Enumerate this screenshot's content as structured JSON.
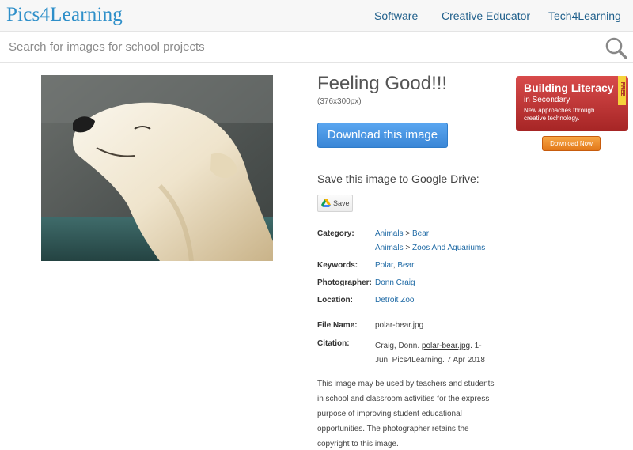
{
  "header": {
    "logo": "Pics4Learning",
    "nav": [
      "Software",
      "Creative Educator",
      "Tech4Learning"
    ]
  },
  "search": {
    "placeholder": "Search for images for school projects",
    "icon": "search-icon"
  },
  "image": {
    "title": "Feeling Good!!!",
    "dimensions": "(376x300px)",
    "download_label": "Download this image"
  },
  "drive": {
    "label": "Save this image to Google Drive:",
    "button_label": "Save"
  },
  "details": {
    "category_label": "Category:",
    "category1": {
      "a": "Animals",
      "sep": " > ",
      "b": "Bear"
    },
    "category2": {
      "a": "Animals",
      "sep": " > ",
      "b": "Zoos And Aquariums"
    },
    "keywords_label": "Keywords:",
    "keywords": {
      "a": "Polar",
      "sep": ", ",
      "b": "Bear"
    },
    "photographer_label": "Photographer:",
    "photographer": "Donn Craig",
    "location_label": "Location:",
    "location": "Detroit Zoo",
    "filename_label": "File Name:",
    "filename": "polar-bear.jpg",
    "citation_label": "Citation:",
    "citation": {
      "pre": "Craig, Donn. ",
      "file": "polar-bear.jpg",
      "post": ". 1-Jun. Pics4Learning. 7 Apr 2018"
    }
  },
  "usage_note": "This image may be used by teachers and students in school and classroom activities for the express purpose of improving student educational opportunities. The photographer retains the copyright to this image.",
  "ad": {
    "title": "Building Literacy",
    "subtitle": "in Secondary",
    "desc": "New approaches through creative technology.",
    "badge": "FREE",
    "button_label": "Download Now"
  },
  "colors": {
    "brand": "#2e8fc9",
    "link": "#1f6aa5",
    "button": "#3a86d6"
  }
}
